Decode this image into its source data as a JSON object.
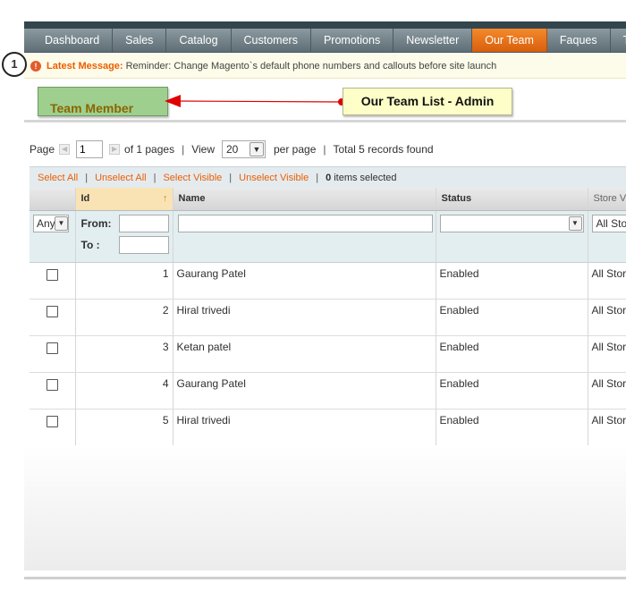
{
  "nav": {
    "items": [
      {
        "label": "Dashboard"
      },
      {
        "label": "Sales"
      },
      {
        "label": "Catalog"
      },
      {
        "label": "Customers"
      },
      {
        "label": "Promotions"
      },
      {
        "label": "Newsletter"
      },
      {
        "label": "Our Team",
        "active": true
      },
      {
        "label": "Faques"
      },
      {
        "label": "To"
      }
    ]
  },
  "message": {
    "icon": "alert-icon",
    "label": "Latest Message:",
    "text": "Reminder: Change Magento`s default phone numbers and callouts before site launch"
  },
  "annotations": {
    "callout_number": "1",
    "team_member": "Team Member",
    "admin_label": "Our Team List - Admin",
    "arrow_color": "#e00000"
  },
  "pager": {
    "page_label": "Page",
    "page_value": "1",
    "of_pages": "of 1 pages",
    "view_label": "View",
    "view_value": "20",
    "per_page": "per page",
    "total": "Total 5 records found"
  },
  "massaction": {
    "select_all": "Select All",
    "unselect_all": "Unselect All",
    "select_visible": "Select Visible",
    "unselect_visible": "Unselect Visible",
    "count": "0",
    "items_selected": "items selected"
  },
  "grid": {
    "columns": {
      "id": "Id",
      "name": "Name",
      "status": "Status",
      "store": "Store View"
    },
    "filter": {
      "any": "Any",
      "from": "From:",
      "to": "To :",
      "store_value": "All Store Views"
    },
    "rows": [
      {
        "id": "1",
        "name": "Gaurang Patel",
        "status": "Enabled",
        "store": "All Store Views"
      },
      {
        "id": "2",
        "name": "Hiral trivedi",
        "status": "Enabled",
        "store": "All Store Views"
      },
      {
        "id": "3",
        "name": "Ketan patel",
        "status": "Enabled",
        "store": "All Store Views"
      },
      {
        "id": "4",
        "name": "Gaurang Patel",
        "status": "Enabled",
        "store": "All Store Views"
      },
      {
        "id": "5",
        "name": "Hiral trivedi",
        "status": "Enabled",
        "store": "All Store Views"
      }
    ]
  }
}
